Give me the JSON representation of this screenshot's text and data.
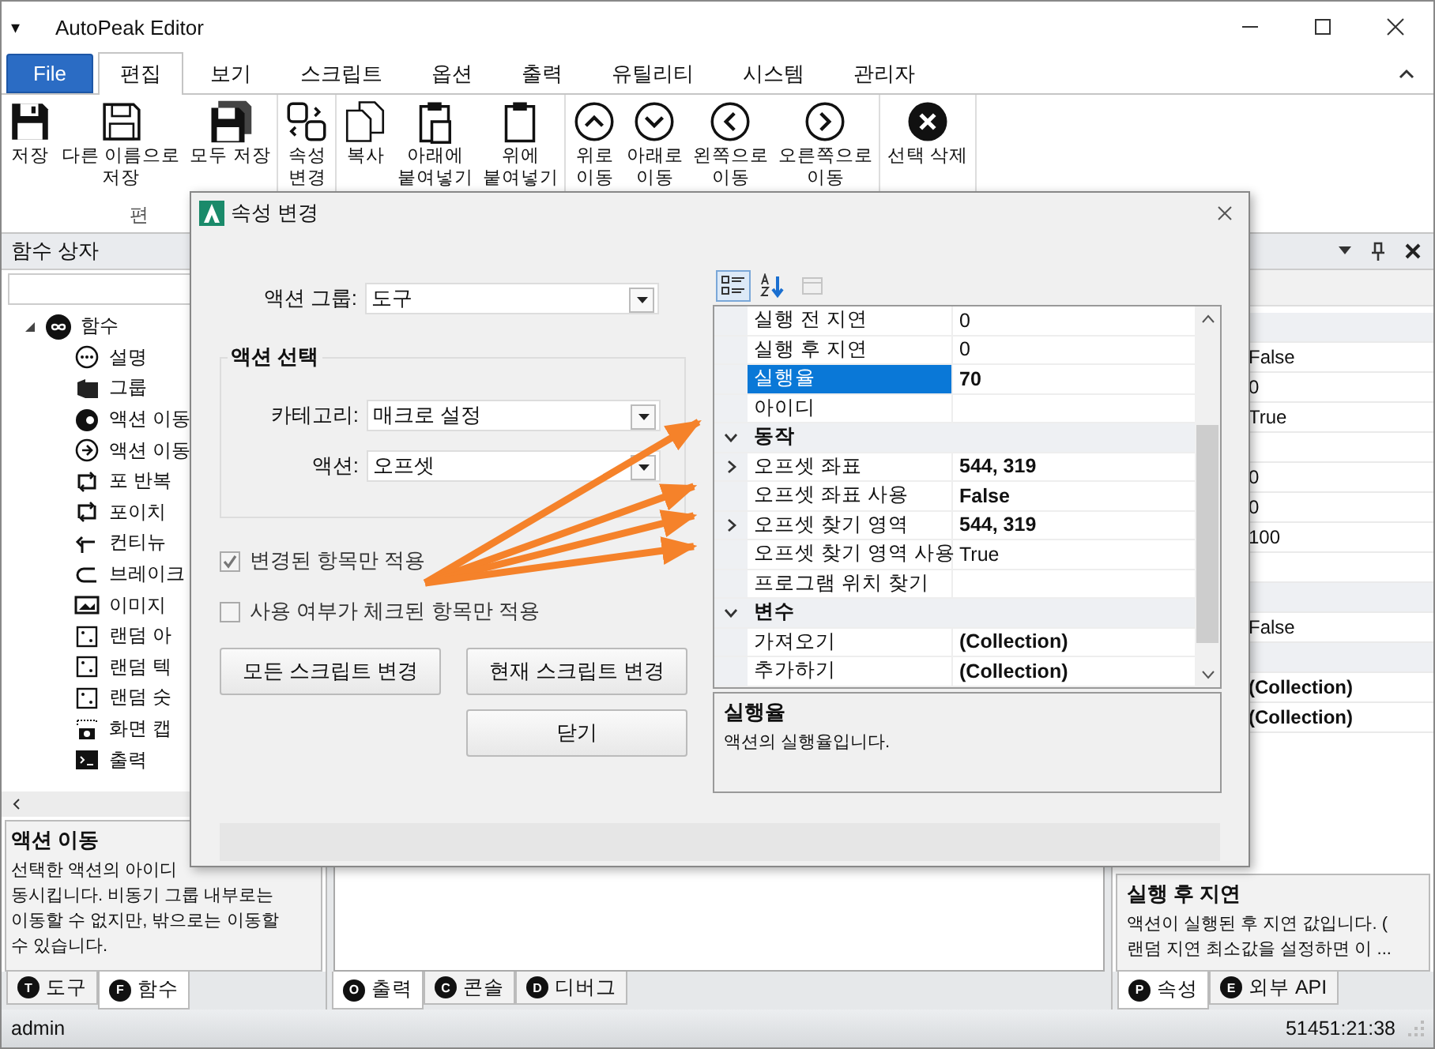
{
  "window": {
    "menu_glyph": "▾",
    "title": "AutoPeak Editor"
  },
  "ribbon": {
    "file_label": "File",
    "tabs": [
      {
        "label": "편집",
        "selected": true
      },
      {
        "label": "보기",
        "selected": false
      },
      {
        "label": "스크립트",
        "selected": false
      },
      {
        "label": "옵션",
        "selected": false
      },
      {
        "label": "출력",
        "selected": false
      },
      {
        "label": "유틸리티",
        "selected": false
      },
      {
        "label": "시스템",
        "selected": false
      },
      {
        "label": "관리자",
        "selected": false
      }
    ],
    "groups": [
      {
        "label": "편",
        "buttons": [
          {
            "kind": "save",
            "label": "저장"
          },
          {
            "kind": "save-as",
            "label": "다른 이름으로\n저장"
          },
          {
            "kind": "save-all",
            "label": "모두 저장"
          }
        ]
      },
      {
        "buttons": [
          {
            "kind": "properties",
            "label": "속성\n변경"
          }
        ]
      },
      {
        "buttons": [
          {
            "kind": "copy",
            "label": "복사"
          },
          {
            "kind": "paste-below",
            "label": "아래에\n붙여넣기"
          },
          {
            "kind": "paste-above",
            "label": "위에\n붙여넣기"
          }
        ]
      },
      {
        "buttons": [
          {
            "kind": "up",
            "label": "위로\n이동"
          },
          {
            "kind": "down",
            "label": "아래로\n이동"
          },
          {
            "kind": "left",
            "label": "왼쪽으로\n이동"
          },
          {
            "kind": "right",
            "label": "오른쪽으로\n이동"
          }
        ]
      },
      {
        "buttons": [
          {
            "kind": "delete",
            "label": "선택 삭제"
          }
        ]
      }
    ]
  },
  "functions_panel": {
    "title": "함수 상자",
    "tree": [
      {
        "kind": "root",
        "label": "함수",
        "expanded": true,
        "children": [
          {
            "kind": "comment",
            "label": "설명"
          },
          {
            "kind": "group",
            "label": "그룹"
          },
          {
            "kind": "goto",
            "label": "액션 이동"
          },
          {
            "kind": "goto-outline",
            "label": "액션 이동"
          },
          {
            "kind": "loop",
            "label": "포 반복"
          },
          {
            "kind": "loop",
            "label": "포이치"
          },
          {
            "kind": "continue",
            "label": "컨티뉴"
          },
          {
            "kind": "break",
            "label": "브레이크"
          },
          {
            "kind": "image",
            "label": "이미지"
          },
          {
            "kind": "random",
            "label": "랜덤 아"
          },
          {
            "kind": "random",
            "label": "랜덤 텍"
          },
          {
            "kind": "random",
            "label": "랜덤 숫"
          },
          {
            "kind": "capture",
            "label": "화면 캡"
          },
          {
            "kind": "console",
            "label": "출력"
          }
        ]
      }
    ],
    "description": {
      "title": "액션 이동",
      "text": "선택한 액션의 아이디\n동시킵니다. 비동기 그룹 내부로는\n이동할 수 없지만, 밖으로는 이동할\n수 있습니다."
    },
    "tabs": [
      {
        "badge": "T",
        "label": "도구",
        "selected": false
      },
      {
        "badge": "F",
        "label": "함수",
        "selected": true
      }
    ]
  },
  "output_panel": {
    "tabs": [
      {
        "badge": "O",
        "label": "출력",
        "selected": true
      },
      {
        "badge": "C",
        "label": "콘솔",
        "selected": false
      },
      {
        "badge": "D",
        "label": "디버그",
        "selected": false
      }
    ]
  },
  "properties_panel": {
    "rows": [
      {
        "kind": "category"
      },
      {
        "kind": "property",
        "value": "False",
        "modified": false
      },
      {
        "kind": "property",
        "value": "0",
        "modified": false
      },
      {
        "kind": "property",
        "value": "True",
        "modified": false
      },
      {
        "kind": "property",
        "value": ""
      },
      {
        "kind": "property",
        "value": "0",
        "modified": false
      },
      {
        "kind": "property",
        "value": "0",
        "modified": false
      },
      {
        "kind": "property",
        "value": "100",
        "modified": false
      },
      {
        "kind": "property",
        "value": ""
      },
      {
        "kind": "category"
      },
      {
        "kind": "property",
        "value": "False",
        "modified": false
      },
      {
        "kind": "category"
      },
      {
        "kind": "property",
        "value": "(Collection)",
        "modified": true
      },
      {
        "kind": "property",
        "value": "(Collection)",
        "modified": true
      }
    ],
    "description": {
      "title": "실행 후 지연",
      "text": "액션이 실행된 후 지연 값입니다. (\n랜덤 지연 최소값을 설정하면 이 ..."
    },
    "tabs": [
      {
        "badge": "P",
        "label": "속성",
        "selected": true
      },
      {
        "badge": "E",
        "label": "외부 API",
        "selected": false
      }
    ]
  },
  "dialog": {
    "title": "속성 변경",
    "action_group": {
      "label": "액션 그룹:",
      "value": "도구"
    },
    "selection": {
      "title": "액션 선택",
      "fields": [
        {
          "label": "카테고리:",
          "value": "매크로 설정"
        },
        {
          "label": "액션:",
          "value": "오프셋"
        }
      ]
    },
    "options": [
      {
        "label": "변경된 항목만 적용",
        "checked": true
      },
      {
        "label": "사용 여부가 체크된 항목만 적용",
        "checked": false
      }
    ],
    "buttons": [
      "모든 스크립트 변경",
      "현재 스크립트 변경",
      "닫기"
    ],
    "grid_toolbar": [
      {
        "kind": "categorized",
        "selected": true,
        "disabled": false
      },
      {
        "kind": "alphabetical",
        "selected": false,
        "disabled": false
      },
      {
        "kind": "pages",
        "selected": false,
        "disabled": true
      }
    ],
    "rows": [
      {
        "kind": "property",
        "label": "실행 전 지연",
        "value": "0",
        "modified": false,
        "selected": false,
        "expandable": false
      },
      {
        "kind": "property",
        "label": "실행 후 지연",
        "value": "0",
        "modified": false,
        "selected": false,
        "expandable": false
      },
      {
        "kind": "property",
        "label": "실행율",
        "value": "70",
        "modified": true,
        "selected": true,
        "expandable": false
      },
      {
        "kind": "property",
        "label": "아이디",
        "value": "",
        "selected": false,
        "expandable": false
      },
      {
        "kind": "category",
        "label": "동작",
        "expanded": true
      },
      {
        "kind": "property",
        "label": "오프셋 좌표",
        "value": "544, 319",
        "modified": true,
        "selected": false,
        "expandable": true
      },
      {
        "kind": "property",
        "label": "오프셋 좌표 사용",
        "value": "False",
        "modified": true,
        "selected": false,
        "expandable": false
      },
      {
        "kind": "property",
        "label": "오프셋 찾기 영역",
        "value": "544, 319",
        "modified": true,
        "selected": false,
        "expandable": true
      },
      {
        "kind": "property",
        "label": "오프셋 찾기 영역 사용",
        "value": "True",
        "modified": false,
        "selected": false,
        "expandable": false
      },
      {
        "kind": "property",
        "label": "프로그램 위치 찾기",
        "value": "",
        "selected": false,
        "expandable": false
      },
      {
        "kind": "category",
        "label": "변수",
        "expanded": true
      },
      {
        "kind": "property",
        "label": "가져오기",
        "value": "(Collection)",
        "modified": true,
        "selected": false,
        "expandable": false
      },
      {
        "kind": "property",
        "label": "추가하기",
        "value": "(Collection)",
        "modified": true,
        "selected": false,
        "expandable": false
      }
    ],
    "help": {
      "title": "실행율",
      "text": "액션의 실행율입니다."
    }
  },
  "status_bar": {
    "user": "admin",
    "time": "51451:21:38"
  }
}
